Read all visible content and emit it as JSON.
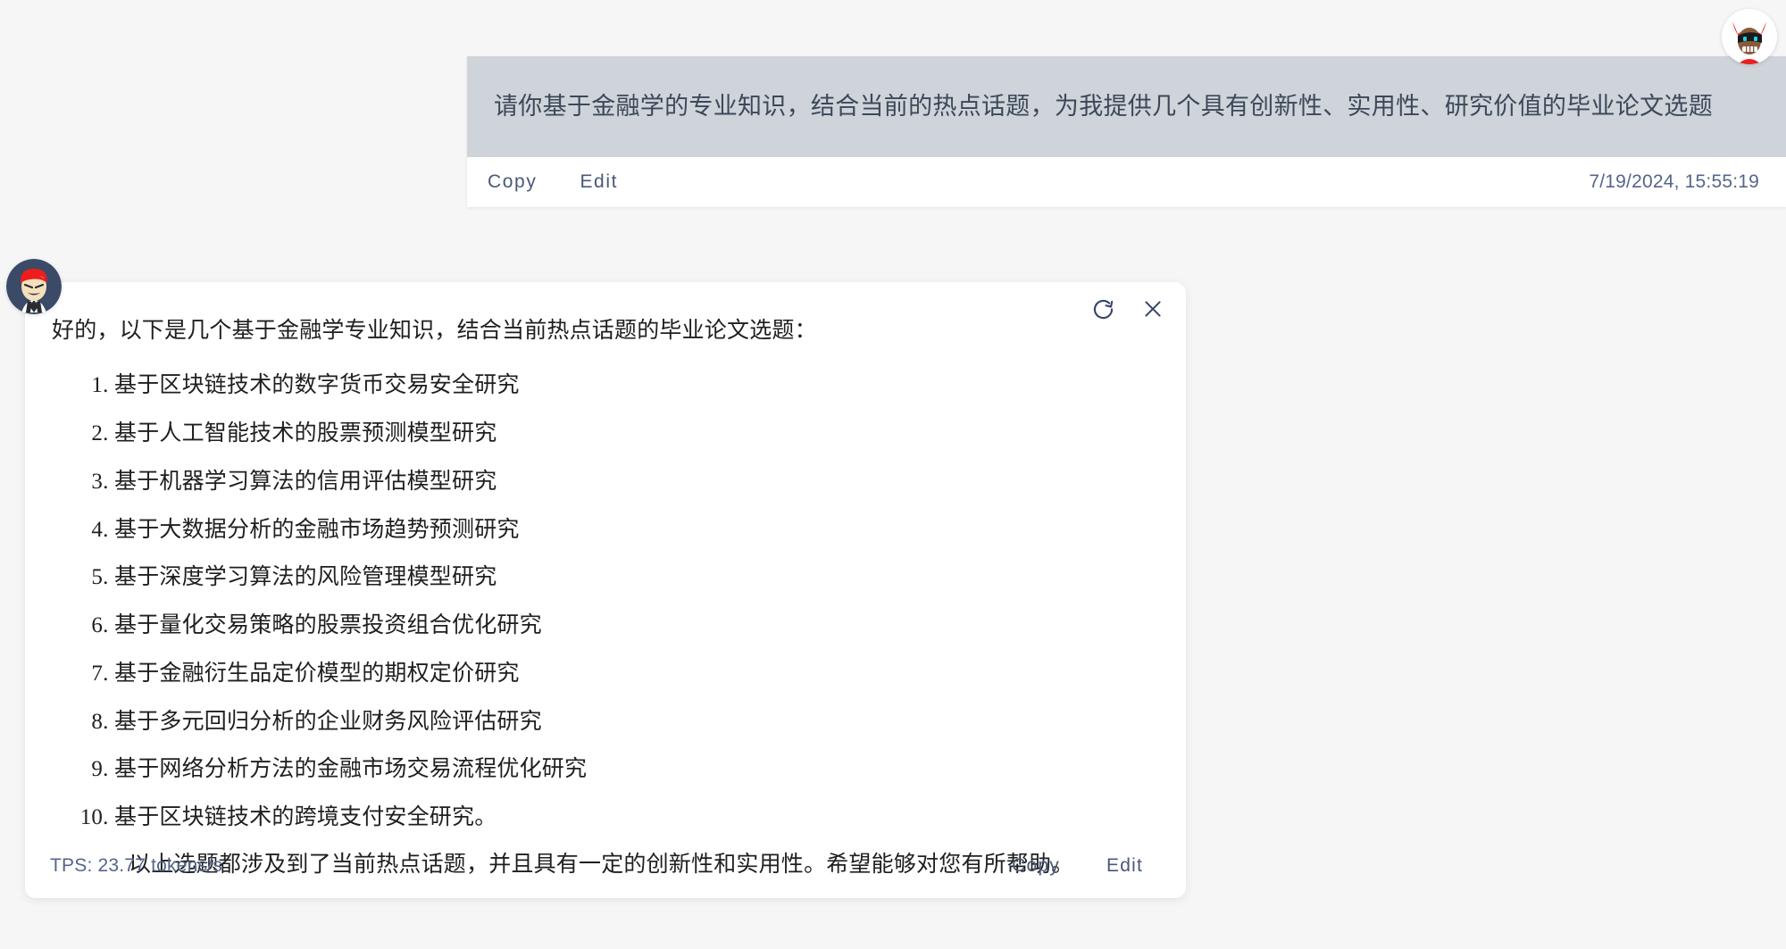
{
  "theme": {
    "page_background": "#f6f6f7",
    "user_bubble_background": "#ced4da",
    "card_background": "#ffffff",
    "link_color": "#4a5878",
    "body_text_color": "#1f1f1f",
    "meta_text_color": "#55658a"
  },
  "user_message": {
    "text": "请你基于金融学的专业知识，结合当前的热点话题，为我提供几个具有创新性、实用性、研究价值的毕业论文选题",
    "copy_label": "Copy",
    "edit_label": "Edit",
    "timestamp": "7/19/2024, 15:55:19"
  },
  "user_avatar": {
    "icon": "user-avatar-red-horns"
  },
  "assistant_message": {
    "avatar_icon": "assistant-avatar-red-hair",
    "regenerate_icon": "refresh-icon",
    "close_icon": "close-icon",
    "intro": "好的，以下是几个基于金融学专业知识，结合当前热点话题的毕业论文选题：",
    "topics": [
      "基于区块链技术的数字货币交易安全研究",
      "基于人工智能技术的股票预测模型研究",
      "基于机器学习算法的信用评估模型研究",
      "基于大数据分析的金融市场趋势预测研究",
      "基于深度学习算法的风险管理模型研究",
      "基于量化交易策略的股票投资组合优化研究",
      "基于金融衍生品定价模型的期权定价研究",
      "基于多元回归分析的企业财务风险评估研究",
      "基于网络分析方法的金融市场交易流程优化研究",
      "基于区块链技术的跨境支付安全研究。"
    ],
    "closing": "以上选题都涉及到了当前热点话题，并且具有一定的创新性和实用性。希望能够对您有所帮助。",
    "tps": "TPS: 23.77 tokens/s",
    "copy_label": "Copy",
    "edit_label": "Edit"
  }
}
